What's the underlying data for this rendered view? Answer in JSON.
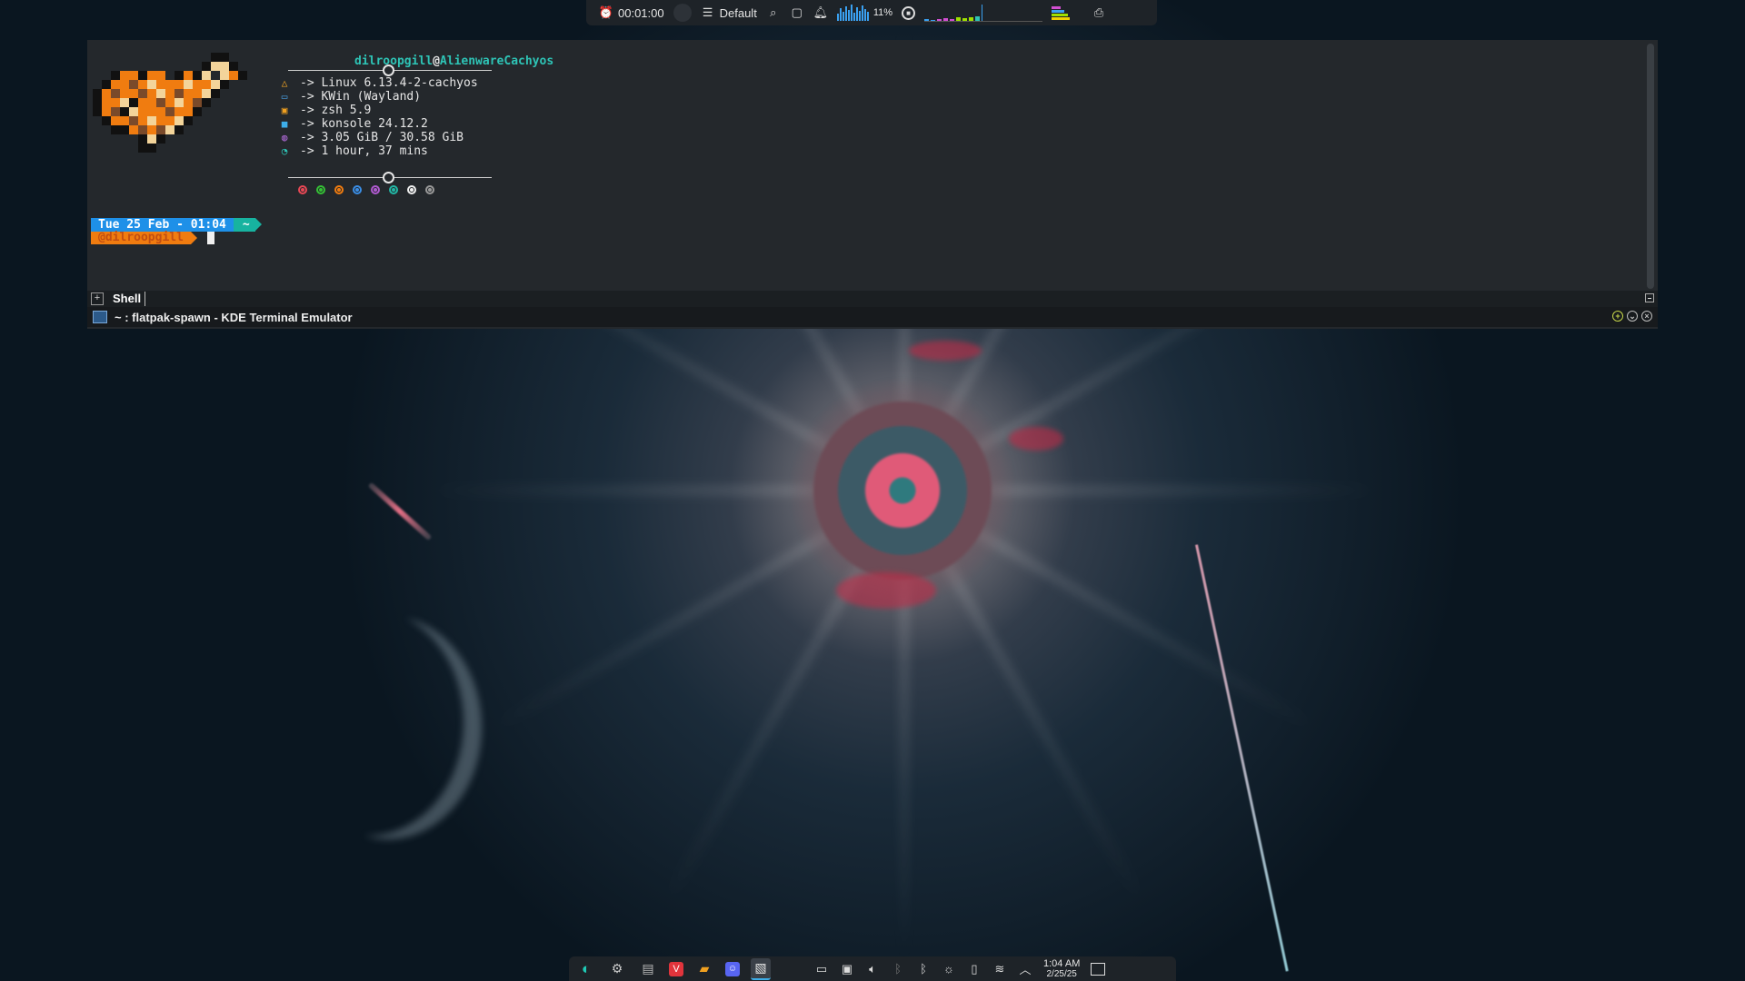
{
  "top_panel": {
    "timer": "00:01:00",
    "profile": "Default",
    "cpu_percent_label": "11%",
    "icons": [
      "alarm-icon",
      "moon-icon",
      "profile-icon",
      "search-icon",
      "clipboard-icon",
      "bell-icon",
      "cpu-graph",
      "record-icon",
      "network-graph",
      "memory-graph",
      "screenshot-icon"
    ]
  },
  "terminal": {
    "fetch": {
      "user": "dilroopgill",
      "at": "@",
      "host": "AlienwareCachyos",
      "rows": [
        {
          "icon": "arch-icon",
          "icon_color": "#f5a623",
          "text": "-> Linux 6.13.4-2-cachyos"
        },
        {
          "icon": "window-icon",
          "icon_color": "#4aa3e8",
          "text": "-> KWin (Wayland)"
        },
        {
          "icon": "terminal-icon",
          "icon_color": "#f0a020",
          "text": "-> zsh 5.9"
        },
        {
          "icon": "konsole-icon",
          "icon_color": "#3daee9",
          "text": "-> konsole 24.12.2"
        },
        {
          "icon": "memory-icon",
          "icon_color": "#b06ad8",
          "text": "-> 3.05 GiB / 30.58 GiB"
        },
        {
          "icon": "clock-icon",
          "icon_color": "#2ec4b6",
          "text": "-> 1 hour, 37 mins"
        }
      ],
      "color_dots": [
        "#e84855",
        "#35c135",
        "#f07c10",
        "#3a8ee6",
        "#b05ad0",
        "#22b8a6",
        "#f0f0f0",
        "#9a9a9a"
      ]
    },
    "prompt": {
      "date": "Tue 25 Feb - 01:04",
      "dir": "~",
      "user": "@dilroopgill"
    },
    "tab_label": "Shell",
    "window_title": "~ : flatpak-spawn - KDE Terminal Emulator"
  },
  "taskbar": {
    "apps": [
      "cachyos-logo-icon",
      "system-settings-icon",
      "terminal-app-icon",
      "vivaldi-icon",
      "file-manager-icon",
      "discord-icon",
      "kate-icon"
    ],
    "tray": [
      "konsole-tray-icon",
      "clipboard-tray-icon",
      "volume-icon",
      "bluetooth-off-icon",
      "bluetooth-icon",
      "brightness-icon",
      "battery-icon",
      "wifi-icon",
      "chevron-up-icon"
    ],
    "time": "1:04 AM",
    "date": "2/25/25"
  }
}
